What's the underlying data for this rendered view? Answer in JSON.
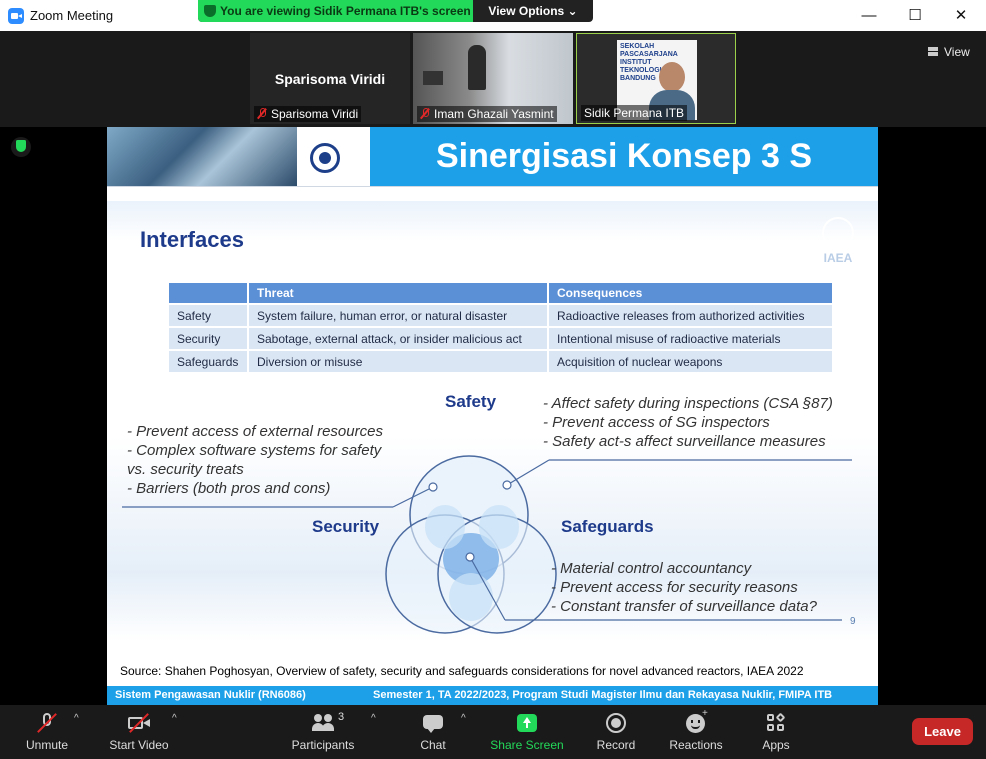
{
  "window": {
    "title": "Zoom Meeting",
    "controls": {
      "minimize": "—",
      "maximize": "☐",
      "close": "✕"
    }
  },
  "share_banner": {
    "text": "You are viewing Sidik Permana ITB's screen",
    "view_options": "View Options ⌄"
  },
  "gallery": {
    "view_label": "View",
    "participants": [
      {
        "name": "Sparisoma Viridi",
        "display_name": "Sparisoma Viridi",
        "muted": true,
        "video": false
      },
      {
        "name": "Imam Ghazali Yasmint",
        "muted": true,
        "video": true
      },
      {
        "name": "Sidik Permana ITB",
        "muted": false,
        "video": true,
        "active_speaker": true,
        "backdrop_text": "SEKOLAH PASCASARJANA INSTITUT TEKNOLOGI BANDUNG"
      }
    ]
  },
  "slide": {
    "header_title": "Sinergisasi Konsep 3 S",
    "section_title": "Interfaces",
    "logo_text": "IAEA",
    "table": {
      "headers": [
        "",
        "Threat",
        "Consequences"
      ],
      "rows": [
        [
          "Safety",
          "System failure, human error, or natural disaster",
          "Radioactive releases from authorized activities"
        ],
        [
          "Security",
          "Sabotage, external attack, or insider malicious act",
          "Intentional  misuse of radioactive materials"
        ],
        [
          "Safeguards",
          "Diversion or misuse",
          "Acquisition of nuclear weapons"
        ]
      ]
    },
    "venn": {
      "labels": {
        "safety": "Safety",
        "security": "Security",
        "safeguards": "Safeguards"
      },
      "left_notes": [
        "- Prevent access of external resources",
        "- Complex software systems for safety",
        "vs. security treats",
        "- Barriers (both pros and cons)"
      ],
      "right_top_notes": [
        "- Affect safety during inspections (CSA §87)",
        "- Prevent access of SG inspectors",
        "- Safety act-s affect surveillance measures"
      ],
      "right_bottom_notes": [
        "- Material control accountancy",
        "- Prevent access for security reasons",
        "- Constant transfer of surveillance data?"
      ]
    },
    "page_number": "9",
    "source": "Source: Shahen Poghosyan, Overview of safety, security and safeguards considerations for novel advanced reactors, IAEA 2022",
    "footer_left": "Sistem Pengawasan Nuklir (RN6086)",
    "footer_right": "Semester 1, TA 2022/2023, Program Studi Magister Ilmu dan Rekayasa Nuklir, FMIPA ITB"
  },
  "toolbar": {
    "unmute": "Unmute",
    "start_video": "Start Video",
    "participants": "Participants",
    "participants_count": "3",
    "chat": "Chat",
    "share_screen": "Share Screen",
    "record": "Record",
    "reactions": "Reactions",
    "apps": "Apps",
    "leave": "Leave"
  },
  "colors": {
    "accent_green": "#23d959",
    "slide_blue": "#1ea0e8",
    "leave_red": "#c62828"
  }
}
